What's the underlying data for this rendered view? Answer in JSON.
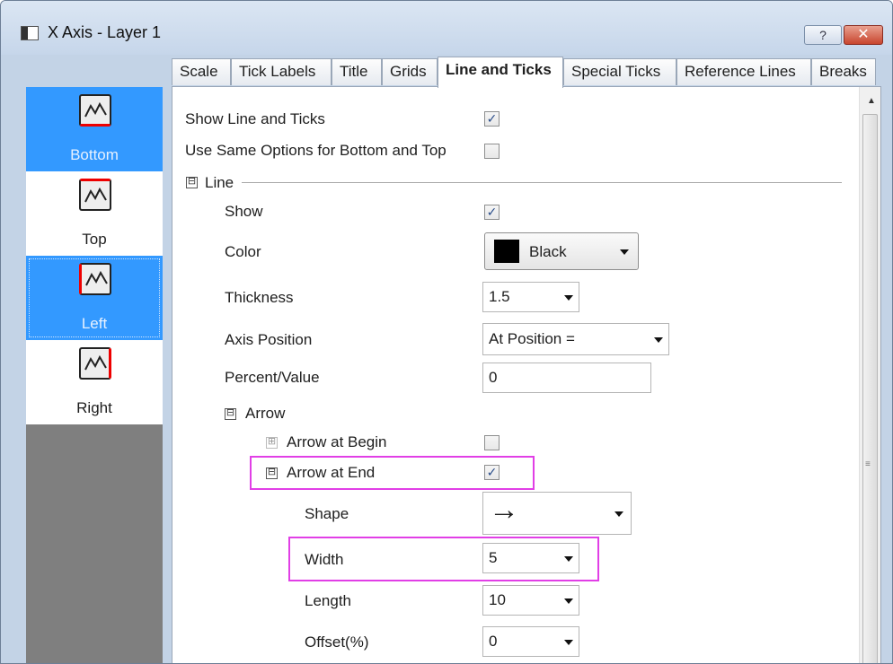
{
  "window": {
    "title": "X Axis - Layer 1",
    "help_label": "?",
    "close_label": "✕"
  },
  "sidebar": {
    "items": [
      {
        "label": "Bottom"
      },
      {
        "label": "Top"
      },
      {
        "label": "Left"
      },
      {
        "label": "Right"
      }
    ]
  },
  "tabs": [
    "Scale",
    "Tick Labels",
    "Title",
    "Grids",
    "Line and Ticks",
    "Special Ticks",
    "Reference Lines",
    "Breaks"
  ],
  "active_tab": "Line and Ticks",
  "options": {
    "show_line_and_ticks": {
      "label": "Show Line and Ticks",
      "checked": true
    },
    "use_same_options": {
      "label": "Use Same Options for Bottom and Top",
      "checked": false
    },
    "line_section": {
      "label": "Line",
      "expander": "⊟"
    },
    "show": {
      "label": "Show",
      "checked": true
    },
    "color": {
      "label": "Color",
      "value": "Black",
      "swatch": "#000000"
    },
    "thickness": {
      "label": "Thickness",
      "value": "1.5"
    },
    "axis_position": {
      "label": "Axis Position",
      "value": "At Position ="
    },
    "percent_value": {
      "label": "Percent/Value",
      "value": "0"
    },
    "arrow_section": {
      "label": "Arrow",
      "expander": "⊟"
    },
    "arrow_at_begin": {
      "label": "Arrow at Begin",
      "checked": false,
      "expander": "⊞"
    },
    "arrow_at_end": {
      "label": "Arrow at End",
      "checked": true,
      "expander": "⊟"
    },
    "shape": {
      "label": "Shape",
      "value": "→"
    },
    "width": {
      "label": "Width",
      "value": "5"
    },
    "length": {
      "label": "Length",
      "value": "10"
    },
    "offset": {
      "label": "Offset(%)",
      "value": "0"
    }
  },
  "check_glyph": "✓",
  "highlight_color": "#e13fe6",
  "selection_color": "#3399ff"
}
